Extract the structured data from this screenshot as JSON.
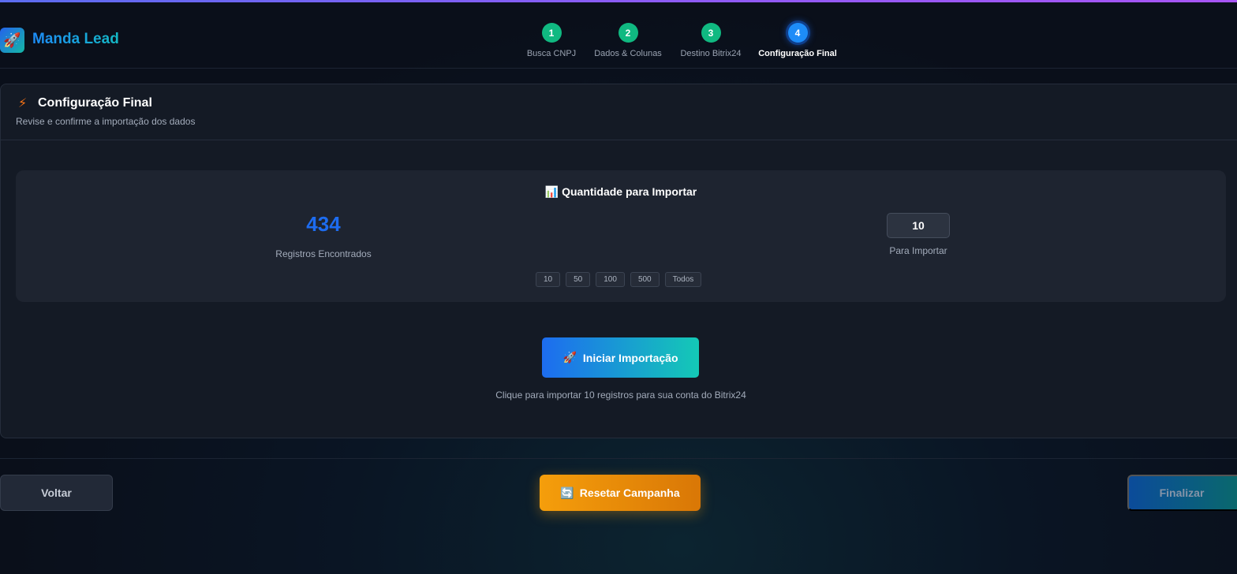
{
  "app": {
    "name": "Manda Lead",
    "logo_icon": "🚀"
  },
  "steps": [
    {
      "number": "1",
      "label": "Busca CNPJ",
      "state": "done"
    },
    {
      "number": "2",
      "label": "Dados & Colunas",
      "state": "done"
    },
    {
      "number": "3",
      "label": "Destino Bitrix24",
      "state": "done"
    },
    {
      "number": "4",
      "label": "Configuração Final",
      "state": "active"
    }
  ],
  "card": {
    "title": "Configuração Final",
    "title_icon": "⚡",
    "subtitle": "Revise e confirme a importação dos dados"
  },
  "quantity": {
    "title": "📊 Quantidade para Importar",
    "found_count": "434",
    "found_label": "Registros Encontrados",
    "input_value": "10",
    "input_label": "Para Importar",
    "presets": [
      "10",
      "50",
      "100",
      "500",
      "Todos"
    ]
  },
  "import": {
    "button_icon": "🚀",
    "button_label": "Iniciar Importação",
    "hint": "Clique para importar 10 registros para sua conta do Bitrix24"
  },
  "footer": {
    "back_label": "Voltar",
    "reset_icon": "🔄",
    "reset_label": "Resetar Campanha",
    "finish_label": "Finalizar"
  },
  "colors": {
    "accent_blue": "#1d6cf0",
    "accent_teal": "#14c9b6",
    "success_green": "#10b981",
    "warning_orange": "#f59e0b"
  }
}
